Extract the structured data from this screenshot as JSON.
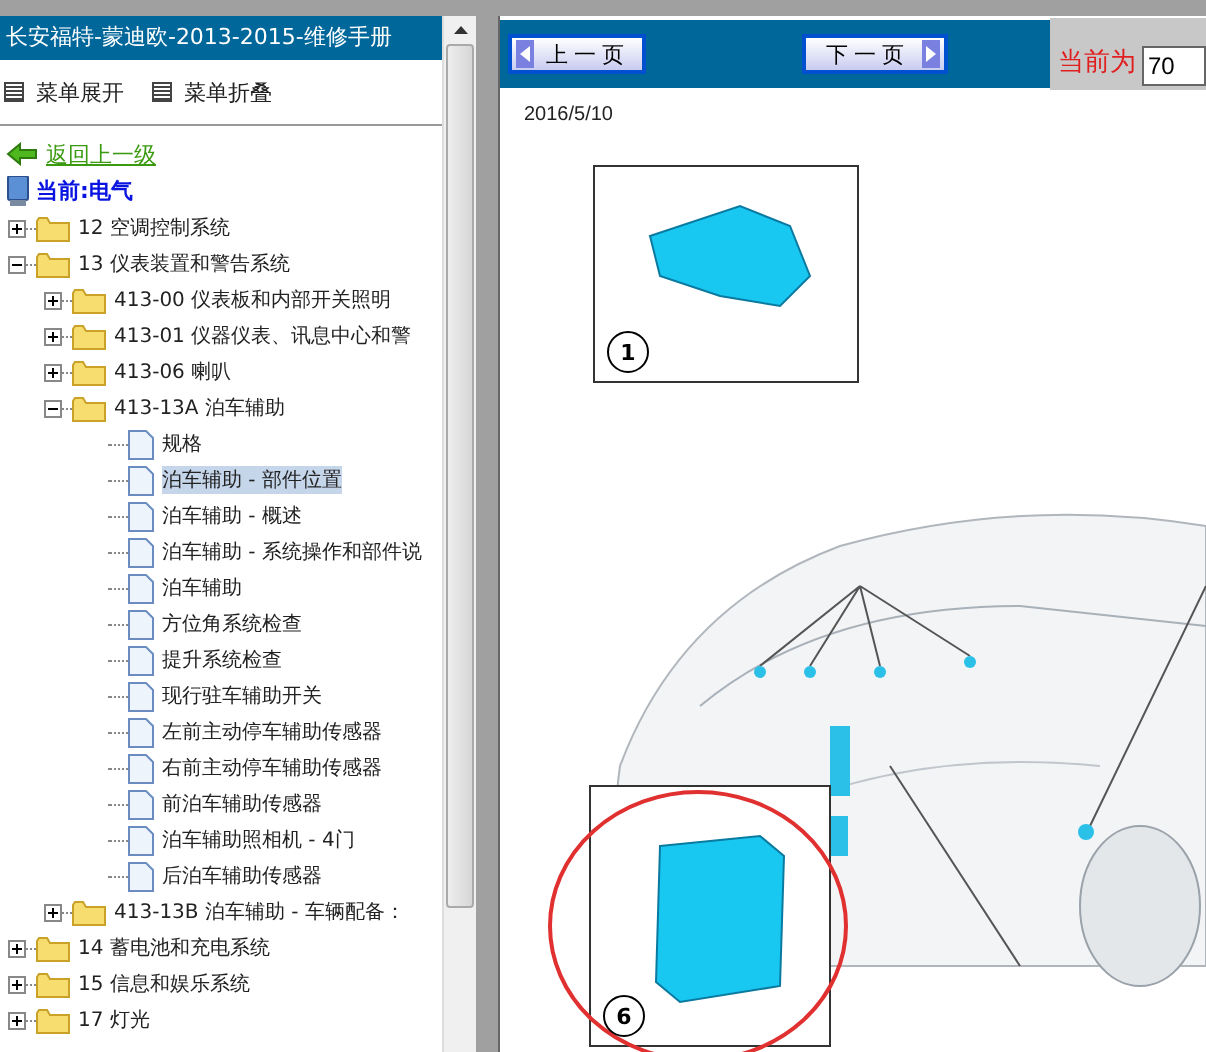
{
  "sidebar": {
    "title": "长安福特-蒙迪欧-2013-2015-维修手册",
    "menu_actions": [
      {
        "label": "菜单展开"
      },
      {
        "label": "菜单折叠"
      }
    ],
    "back_link": "返回上一级",
    "current": "当前:电气",
    "tree": [
      {
        "label": "12 空调控制系统",
        "kind": "folder",
        "expanded": false,
        "selected": false
      },
      {
        "label": "13 仪表装置和警告系统",
        "kind": "folder",
        "expanded": true,
        "selected": false,
        "children": [
          {
            "label": "413-00 仪表板和内部开关照明",
            "kind": "folder",
            "expanded": false,
            "selected": false
          },
          {
            "label": "413-01 仪器仪表、讯息中心和警",
            "kind": "folder",
            "expanded": false,
            "selected": false
          },
          {
            "label": "413-06 喇叭",
            "kind": "folder",
            "expanded": false,
            "selected": false
          },
          {
            "label": "413-13A 泊车辅助",
            "kind": "folder",
            "expanded": true,
            "selected": false,
            "children": [
              {
                "label": "规格",
                "kind": "page",
                "selected": false
              },
              {
                "label": "泊车辅助 - 部件位置",
                "kind": "page",
                "selected": true
              },
              {
                "label": "泊车辅助 - 概述",
                "kind": "page",
                "selected": false
              },
              {
                "label": "泊车辅助 - 系统操作和部件说",
                "kind": "page",
                "selected": false
              },
              {
                "label": "泊车辅助",
                "kind": "page",
                "selected": false
              },
              {
                "label": "方位角系统检查",
                "kind": "page",
                "selected": false
              },
              {
                "label": "提升系统检查",
                "kind": "page",
                "selected": false
              },
              {
                "label": "现行驻车辅助开关",
                "kind": "page",
                "selected": false
              },
              {
                "label": "左前主动停车辅助传感器",
                "kind": "page",
                "selected": false
              },
              {
                "label": "右前主动停车辅助传感器",
                "kind": "page",
                "selected": false
              },
              {
                "label": "前泊车辅助传感器",
                "kind": "page",
                "selected": false
              },
              {
                "label": "泊车辅助照相机 - 4门",
                "kind": "page",
                "selected": false
              },
              {
                "label": "后泊车辅助传感器",
                "kind": "page",
                "selected": false
              }
            ]
          },
          {
            "label": "413-13B 泊车辅助 - 车辆配备：",
            "kind": "folder",
            "expanded": false,
            "selected": false
          }
        ]
      },
      {
        "label": "14 蓄电池和充电系统",
        "kind": "folder",
        "expanded": false,
        "selected": false
      },
      {
        "label": "15 信息和娱乐系统",
        "kind": "folder",
        "expanded": false,
        "selected": false
      },
      {
        "label": "17 灯光",
        "kind": "folder",
        "expanded": false,
        "selected": false
      }
    ]
  },
  "toolbar": {
    "prev_button": "上一页",
    "next_button": "下一页",
    "page_label": "当前为",
    "page_value": "70"
  },
  "document": {
    "date": "2016/5/10",
    "callouts": [
      {
        "number": "1"
      },
      {
        "number": "6"
      }
    ]
  }
}
